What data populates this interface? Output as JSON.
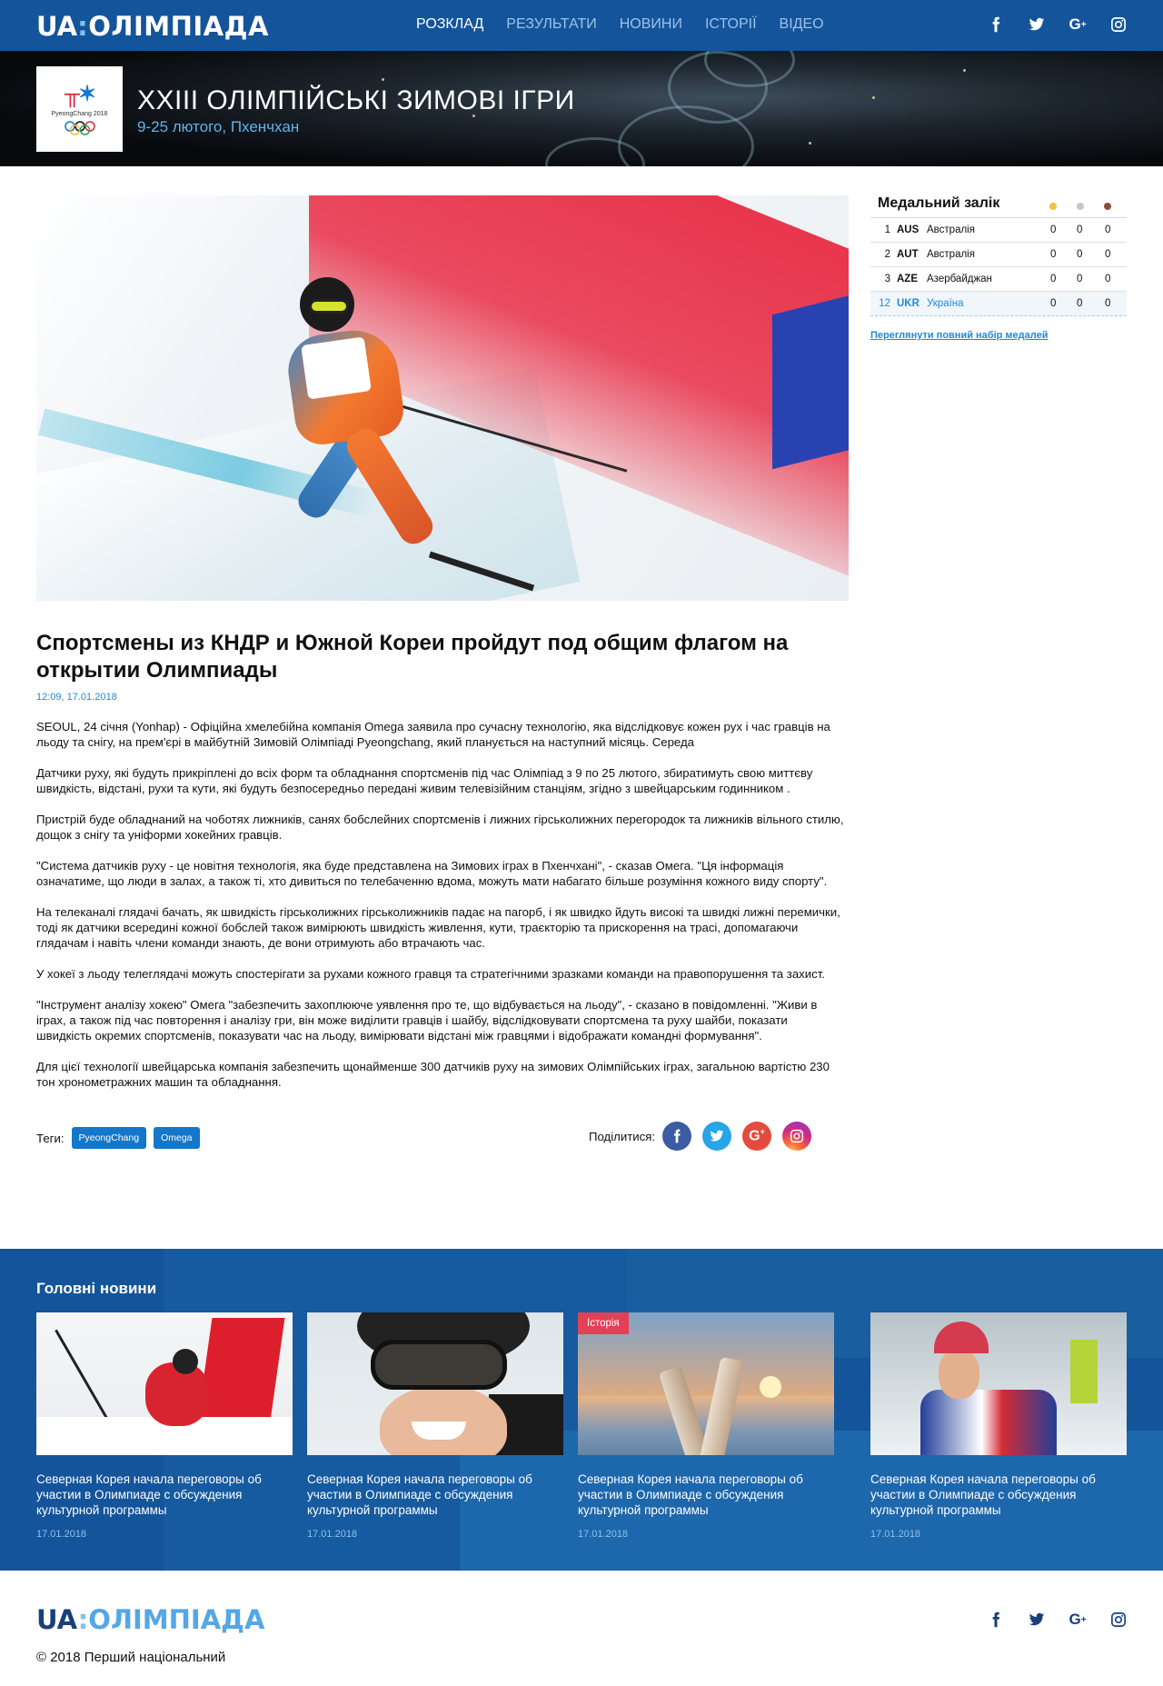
{
  "header": {
    "logo_ua": "UA",
    "logo_slash": ":",
    "logo_name": "ОЛІМПІАДА",
    "nav": [
      {
        "label": "РОЗКЛАД",
        "active": true
      },
      {
        "label": "РЕЗУЛЬТАТИ",
        "active": false
      },
      {
        "label": "НОВИНИ",
        "active": false
      },
      {
        "label": "ІСТОРІЇ",
        "active": false
      },
      {
        "label": "ВІДЕО",
        "active": false
      }
    ],
    "social": [
      "facebook-icon",
      "twitter-icon",
      "google-plus-icon",
      "instagram-icon"
    ]
  },
  "hero": {
    "emblem_caption": "PyeongChang 2018",
    "title": "XXIII ОЛІМПІЙСЬКІ ЗИМОВІ ІГРИ",
    "subtitle": "9-25 лютого, Пхенчхан"
  },
  "article": {
    "title": "Спортсмены из КНДР и Южной Кореи пройдут под общим флагом на открытии Олимпиады",
    "date": "12:09, 17.01.2018",
    "paragraphs": [
      "SEOUL, 24 січня (Yonhap) - Офіційна хмелебійна компанія Omega заявила про сучасну технологію, яка відслідковує кожен рух і час гравців на льоду та снігу, на прем'єрі в майбутній Зимовій Олімпіаді Pyeongchang, який планується на наступний місяць. Середа",
      "Датчики руху, які будуть прикріплені до всіх форм та обладнання спортсменів під час Олімпіад з 9 по 25 лютого, збиратимуть свою миттєву швидкість, відстані, рухи та кути, які будуть безпосередньо передані живим телевізійним станціям, згідно з швейцарським годинником .",
      "Пристрій буде обладнаний на чоботях лижників, санях бобслейних спортсменів і лижних гірськолижних перегородок та лижників вільного стилю, дощок з снігу та уніформи хокейних гравців.",
      "\"Система датчиків руху - це новітня технологія, яка буде представлена на Зимових іграх в Пхенчхані\", - сказав Омега. \"Ця інформація означатиме, що люди в залах, а також ті, хто дивиться по телебаченню вдома, можуть мати набагато більше розуміння кожного виду спорту\".",
      "На телеканалі глядачі бачать, як швидкість гірськолижних гірськолижників падає на пагорб, і як швидко йдуть високі та швидкі лижні перемички, тоді як датчики всередині кожної бобслей також вимірюють швидкість живлення, кути, траєкторію та прискорення на трасі, допомагаючи глядачам і навіть члени команди знають, де вони отримують або втрачають час.",
      "У хокеї з льоду телеглядачі можуть спостерігати за рухами кожного гравця та стратегічними зразками команди на правопорушення та захист.",
      "\"Інструмент аналізу хокею\" Омега \"забезпечить захоплююче уявлення про те, що відбувається на льоду\", - сказано в повідомленні. \"Живи в іграх, а також під час повторення і аналізу гри, він може виділити гравців і шайбу, відслідковувати спортсмена та руху шайби, показати швидкість окремих спортсменів, показувати час на льоду, вимірювати відстані між гравцями і відображати командні формування\".",
      "Для цієї технології швейцарська компанія забезпечить щонайменше 300 датчиків руху на зимових Олімпійських іграх, загальною вартістю 230 тон хронометражних машин та обладнання."
    ],
    "tags_label": "Теги:",
    "tags": [
      "PyeongChang",
      "Omega"
    ],
    "share_label": "Поділитися:",
    "share_icons": [
      "facebook-icon",
      "twitter-icon",
      "google-plus-icon",
      "instagram-icon"
    ]
  },
  "medals": {
    "title": "Медальний залік",
    "colors": {
      "gold": "#f1c141",
      "silver": "#c6c6c6",
      "bronze": "#8e4b3e"
    },
    "rows": [
      {
        "rank": "1",
        "code": "AUS",
        "country": "Австралія",
        "gold": "0",
        "silver": "0",
        "bronze": "0"
      },
      {
        "rank": "2",
        "code": "AUT",
        "country": "Австралія",
        "gold": "0",
        "silver": "0",
        "bronze": "0"
      },
      {
        "rank": "3",
        "code": "AZE",
        "country": "Азербайджан",
        "gold": "0",
        "silver": "0",
        "bronze": "0"
      },
      {
        "rank": "12",
        "code": "UKR",
        "country": "Україна",
        "gold": "0",
        "silver": "0",
        "bronze": "0"
      }
    ],
    "link": "Переглянути повний набір медалей"
  },
  "news": {
    "title": "Головні новини",
    "cards": [
      {
        "badge": "",
        "title": "Северная Корея начала переговоры об участии в Олимпиаде с обсуждения культурной программы",
        "date": "17.01.2018"
      },
      {
        "badge": "",
        "title": "Северная Корея начала переговоры об участии в Олимпиаде с обсуждения культурной программы",
        "date": "17.01.2018"
      },
      {
        "badge": "Історія",
        "title": "Северная Корея начала переговоры об участии в Олимпиаде с обсуждения культурной программы",
        "date": "17.01.2018"
      },
      {
        "badge": "",
        "title": "Северная Корея начала переговоры об участии в Олимпиаде с обсуждения культурной программы",
        "date": "17.01.2018"
      }
    ]
  },
  "footer": {
    "logo_ua": "UA",
    "logo_slash": ":",
    "logo_name": "ОЛІМПІАДА",
    "copyright": "© 2018 Перший національний",
    "social": [
      "facebook-icon",
      "twitter-icon",
      "google-plus-icon",
      "instagram-icon"
    ]
  },
  "colors": {
    "brand_blue": "#14549b",
    "accent_blue": "#1f8bd3",
    "badge_red": "#e34057"
  }
}
